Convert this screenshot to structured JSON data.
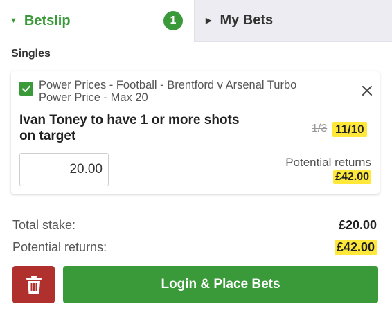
{
  "tabs": {
    "betslip_label": "Betslip",
    "betslip_count": "1",
    "mybets_label": "My Bets"
  },
  "section": {
    "title": "Singles"
  },
  "bet": {
    "market_line1": "Power Prices - Football - Brentford v Arsenal Turbo",
    "market_line2": "Power Price - Max 20",
    "selection_line1": "Ivan Toney to have 1 or more shots",
    "selection_line2": "on target",
    "old_odds": "1/3",
    "new_odds": "11/10",
    "stake": "20.00",
    "potential_returns_label": "Potential returns",
    "potential_returns_value": "£42.00"
  },
  "totals": {
    "stake_label": "Total stake:",
    "stake_value": "£20.00",
    "returns_label": "Potential returns:",
    "returns_value": "£42.00"
  },
  "actions": {
    "place_label": "Login & Place Bets"
  },
  "colors": {
    "brand_green": "#3a9a3a",
    "highlight_yellow": "#ffe83a",
    "delete_red": "#b0302e"
  },
  "icons": {
    "checkbox": "checkmark-icon",
    "close": "close-icon",
    "delete": "trash-icon"
  }
}
